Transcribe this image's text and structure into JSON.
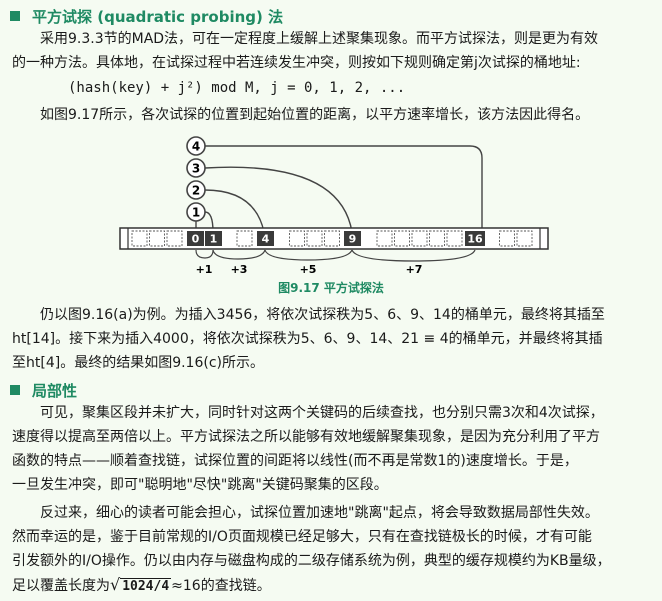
{
  "section1": {
    "heading": "平方试探 (quadratic probing) 法",
    "p1": [
      "采用9.3.3节的MAD法，可在一定程度上缓解上述聚集现象。而平方试探法，则是更为有效",
      "的一种方法。具体地，在试探过程中若连续发生冲突，则按如下规则确定第j次试探的桶地址:"
    ],
    "formula": "(hash(key) + j²) mod M,  j = 0, 1, 2, ...",
    "p2": "如图9.17所示，各次试探的位置到起始位置的距离，以平方速率增长，该方法因此得名。"
  },
  "figure": {
    "caption": "图9.17  平方试探法",
    "probe_circles": [
      "4",
      "3",
      "2",
      "1"
    ],
    "cells": [
      "0",
      "1",
      "4",
      "9",
      "16"
    ],
    "increments": [
      "+1",
      "+3",
      "+5",
      "+7"
    ]
  },
  "section1b": {
    "p3": [
      "仍以图9.16(a)为例。为插入3456，将依次试探秩为5、6、9、14的桶单元，最终将其插至",
      "ht[14]。接下来为插入4000，将依次试探秩为5、6、9、14、21 ≡ 4的桶单元，并最终将其插",
      "至ht[4]。最终的结果如图9.16(c)所示。"
    ]
  },
  "section2": {
    "heading": "局部性",
    "p1": [
      "可见，聚集区段并未扩大，同时针对这两个关键码的后续查找，也分别只需3次和4次试探，",
      "速度得以提高至两倍以上。平方试探法之所以能够有效地缓解聚集现象，是因为充分利用了平方",
      "函数的特点——顺着查找链，试探位置的间距将以线性(而不再是常数1的)速度增长。于是，",
      "一旦发生冲突，即可\"聪明地\"尽快\"跳离\"关键码聚集的区段。"
    ],
    "p2": [
      "反过来，细心的读者可能会担心，试探位置加速地\"跳离\"起点，将会导致数据局部性失效。",
      "然而幸运的是，鉴于目前常规的I/O页面规模已经足够大，只有在查找链极长的时候，才有可能",
      "引发额外的I/O操作。仍以由内存与磁盘构成的二级存储系统为例，典型的缓存规模约为KB量级，"
    ],
    "last_prefix": "足以覆盖长度为",
    "sqrt_expr": "1024/4",
    "last_suffix": "≈16的查找链。"
  }
}
